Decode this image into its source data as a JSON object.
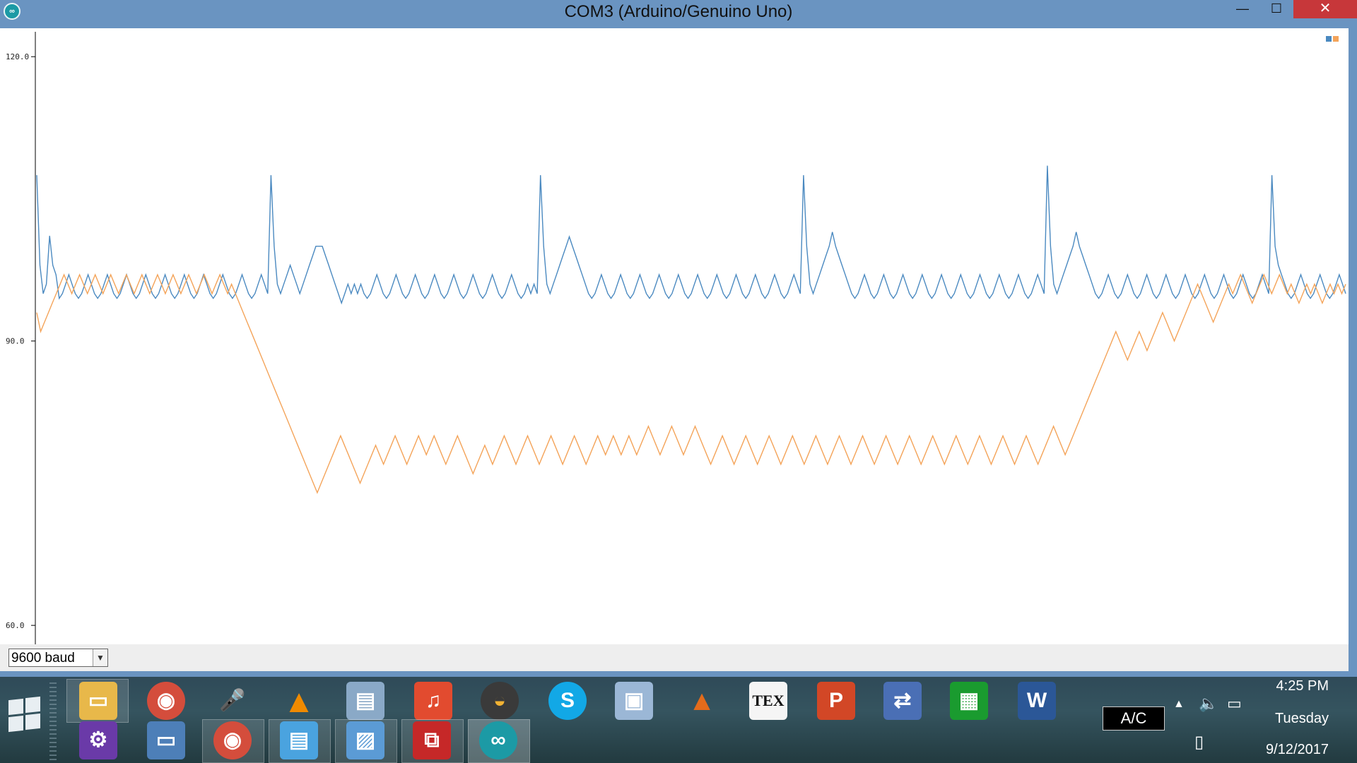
{
  "window": {
    "title": "COM3 (Arduino/Genuino Uno)",
    "minimize_icon": "minimize-icon",
    "maximize_icon": "maximize-icon",
    "close_icon": "close-icon"
  },
  "plotter": {
    "baud": "9600 baud",
    "legend_colors": [
      "#4a89c0",
      "#f4a45a"
    ]
  },
  "chart_data": {
    "type": "line",
    "title": "",
    "ylim": [
      58.0,
      123.0
    ],
    "yticks": [
      "120.0",
      "90.0",
      "60.0"
    ],
    "ytick_values": [
      120,
      90,
      60
    ],
    "x_count": 500,
    "grid": false,
    "legend": "top-right",
    "series": [
      {
        "color": "#4a89c0",
        "values": [
          107.5,
          98,
          95,
          96,
          101.1,
          98,
          97,
          94.5,
          95,
          96,
          97,
          96,
          95,
          94.5,
          95,
          96,
          97,
          96,
          95,
          94.5,
          95,
          96,
          97,
          96,
          95,
          94.5,
          95,
          96,
          97,
          96,
          95,
          94.5,
          95,
          96,
          97,
          96,
          95,
          94.5,
          95,
          96,
          97,
          96,
          95,
          94.5,
          95,
          96,
          97,
          96,
          95,
          94.5,
          95,
          96,
          97,
          96,
          95,
          94.5,
          95,
          96,
          97,
          96,
          95,
          94.5,
          95,
          96,
          97,
          96,
          95,
          94.5,
          95,
          96,
          97,
          96,
          95,
          107.5,
          100,
          96,
          95,
          96,
          97,
          98,
          97,
          96,
          95,
          96,
          97,
          98,
          99,
          100,
          100,
          100,
          99,
          98,
          97,
          96,
          95,
          94,
          95,
          96,
          95,
          96,
          95,
          96,
          95,
          94.5,
          95,
          96,
          97,
          96,
          95,
          94.5,
          95,
          96,
          97,
          96,
          95,
          94.5,
          95,
          96,
          97,
          96,
          95,
          94.5,
          95,
          96,
          97,
          96,
          95,
          94.5,
          95,
          96,
          97,
          96,
          95,
          94.5,
          95,
          96,
          97,
          96,
          95,
          94.5,
          95,
          96,
          97,
          96,
          95,
          94.5,
          95,
          96,
          97,
          96,
          95,
          94.5,
          95,
          96,
          95,
          96,
          95,
          107.5,
          100,
          96,
          95,
          96,
          97,
          98,
          99,
          100,
          101,
          100,
          99,
          98,
          97,
          96,
          95,
          94.5,
          95,
          96,
          97,
          96,
          95,
          94.5,
          95,
          96,
          97,
          96,
          95,
          94.5,
          95,
          96,
          97,
          96,
          95,
          94.5,
          95,
          96,
          97,
          96,
          95,
          94.5,
          95,
          96,
          97,
          96,
          95,
          94.5,
          95,
          96,
          97,
          96,
          95,
          94.5,
          95,
          96,
          97,
          96,
          95,
          94.5,
          95,
          96,
          97,
          96,
          95,
          94.5,
          95,
          96,
          97,
          96,
          95,
          94.5,
          95,
          96,
          97,
          96,
          95,
          94.5,
          95,
          96,
          97,
          96,
          95,
          107.5,
          100,
          96,
          95,
          96,
          97,
          98,
          99,
          100,
          101.5,
          100,
          99,
          98,
          97,
          96,
          95,
          94.5,
          95,
          96,
          97,
          96,
          95,
          94.5,
          95,
          96,
          97,
          96,
          95,
          94.5,
          95,
          96,
          97,
          96,
          95,
          94.5,
          95,
          96,
          97,
          96,
          95,
          94.5,
          95,
          96,
          97,
          96,
          95,
          94.5,
          95,
          96,
          97,
          96,
          95,
          94.5,
          95,
          96,
          97,
          96,
          95,
          94.5,
          95,
          96,
          97,
          96,
          95,
          94.5,
          95,
          96,
          97,
          96,
          95,
          94.5,
          95,
          96,
          97,
          96,
          95,
          108.5,
          100,
          96,
          95,
          96,
          97,
          98,
          99,
          100,
          101.5,
          100,
          99,
          98,
          97,
          96,
          95,
          94.5,
          95,
          96,
          97,
          96,
          95,
          94.5,
          95,
          96,
          97,
          96,
          95,
          94.5,
          95,
          96,
          97,
          96,
          95,
          94.5,
          95,
          96,
          97,
          96,
          95,
          94.5,
          95,
          96,
          97,
          96,
          95,
          94.5,
          95,
          96,
          97,
          96,
          95,
          94.5,
          95,
          96,
          97,
          96,
          95,
          94.5,
          95,
          96,
          97,
          96,
          95,
          94.5,
          95,
          96,
          97,
          96,
          95,
          107.5,
          100,
          98,
          97,
          96,
          95,
          94.5,
          95,
          96,
          97,
          96,
          95,
          94.5,
          95,
          96,
          97,
          96,
          95,
          94.5,
          95,
          96,
          97,
          96,
          95
        ]
      },
      {
        "color": "#f4a45a",
        "values": [
          93,
          91,
          92,
          93,
          94,
          95,
          96,
          97,
          96,
          95,
          96,
          97,
          96,
          95,
          96,
          97,
          96,
          95,
          96,
          97,
          96,
          95,
          96,
          97,
          96,
          95,
          96,
          97,
          96,
          95,
          96,
          97,
          96,
          95,
          96,
          97,
          96,
          95,
          96,
          97,
          96,
          95,
          96,
          97,
          96,
          95,
          96,
          97,
          96,
          95,
          96,
          95,
          94,
          93,
          92,
          91,
          90,
          89,
          88,
          87,
          86,
          85,
          84,
          83,
          82,
          81,
          80,
          79,
          78,
          77,
          76,
          75,
          74,
          75,
          76,
          77,
          78,
          79,
          80,
          79,
          78,
          77,
          76,
          75,
          76,
          77,
          78,
          79,
          78,
          77,
          78,
          79,
          80,
          79,
          78,
          77,
          78,
          79,
          80,
          79,
          78,
          79,
          80,
          79,
          78,
          77,
          78,
          79,
          80,
          79,
          78,
          77,
          76,
          77,
          78,
          79,
          78,
          77,
          78,
          79,
          80,
          79,
          78,
          77,
          78,
          79,
          80,
          79,
          78,
          77,
          78,
          79,
          80,
          79,
          78,
          77,
          78,
          79,
          80,
          79,
          78,
          77,
          78,
          79,
          80,
          79,
          78,
          79,
          80,
          79,
          78,
          79,
          80,
          79,
          78,
          79,
          80,
          81,
          80,
          79,
          78,
          79,
          80,
          81,
          80,
          79,
          78,
          79,
          80,
          81,
          80,
          79,
          78,
          77,
          78,
          79,
          80,
          79,
          78,
          77,
          78,
          79,
          80,
          79,
          78,
          77,
          78,
          79,
          80,
          79,
          78,
          77,
          78,
          79,
          80,
          79,
          78,
          77,
          78,
          79,
          80,
          79,
          78,
          77,
          78,
          79,
          80,
          79,
          78,
          77,
          78,
          79,
          80,
          79,
          78,
          77,
          78,
          79,
          80,
          79,
          78,
          77,
          78,
          79,
          80,
          79,
          78,
          77,
          78,
          79,
          80,
          79,
          78,
          77,
          78,
          79,
          80,
          79,
          78,
          77,
          78,
          79,
          80,
          79,
          78,
          77,
          78,
          79,
          80,
          79,
          78,
          77,
          78,
          79,
          80,
          79,
          78,
          77,
          78,
          79,
          80,
          81,
          80,
          79,
          78,
          79,
          80,
          81,
          82,
          83,
          84,
          85,
          86,
          87,
          88,
          89,
          90,
          91,
          90,
          89,
          88,
          89,
          90,
          91,
          90,
          89,
          90,
          91,
          92,
          93,
          92,
          91,
          90,
          91,
          92,
          93,
          94,
          95,
          96,
          95,
          94,
          93,
          92,
          93,
          94,
          95,
          96,
          95,
          96,
          97,
          96,
          95,
          94,
          95,
          96,
          97,
          96,
          95,
          96,
          97,
          96,
          95,
          96,
          95,
          94,
          95,
          96,
          95,
          96,
          95,
          94,
          95,
          96,
          95,
          96,
          95,
          96
        ]
      }
    ]
  },
  "taskbar": {
    "pinned_row1": [
      "File Explorer",
      "Chrome",
      "Microphone",
      "VLC",
      "Monitor",
      "Music",
      "Arc",
      "Skype",
      "VirtualBox",
      "MATLAB",
      "TeX",
      "PowerPoint",
      "Network",
      "Remote",
      "Word"
    ],
    "pinned_row2": [
      "Settings",
      "Remote Desktop",
      "Chrome Window",
      "Presentation",
      "Photos",
      "Acrobat",
      "Arduino"
    ],
    "ac_label": "A/C",
    "time": "4:25 PM",
    "day": "Tuesday",
    "date": "9/12/2017"
  }
}
